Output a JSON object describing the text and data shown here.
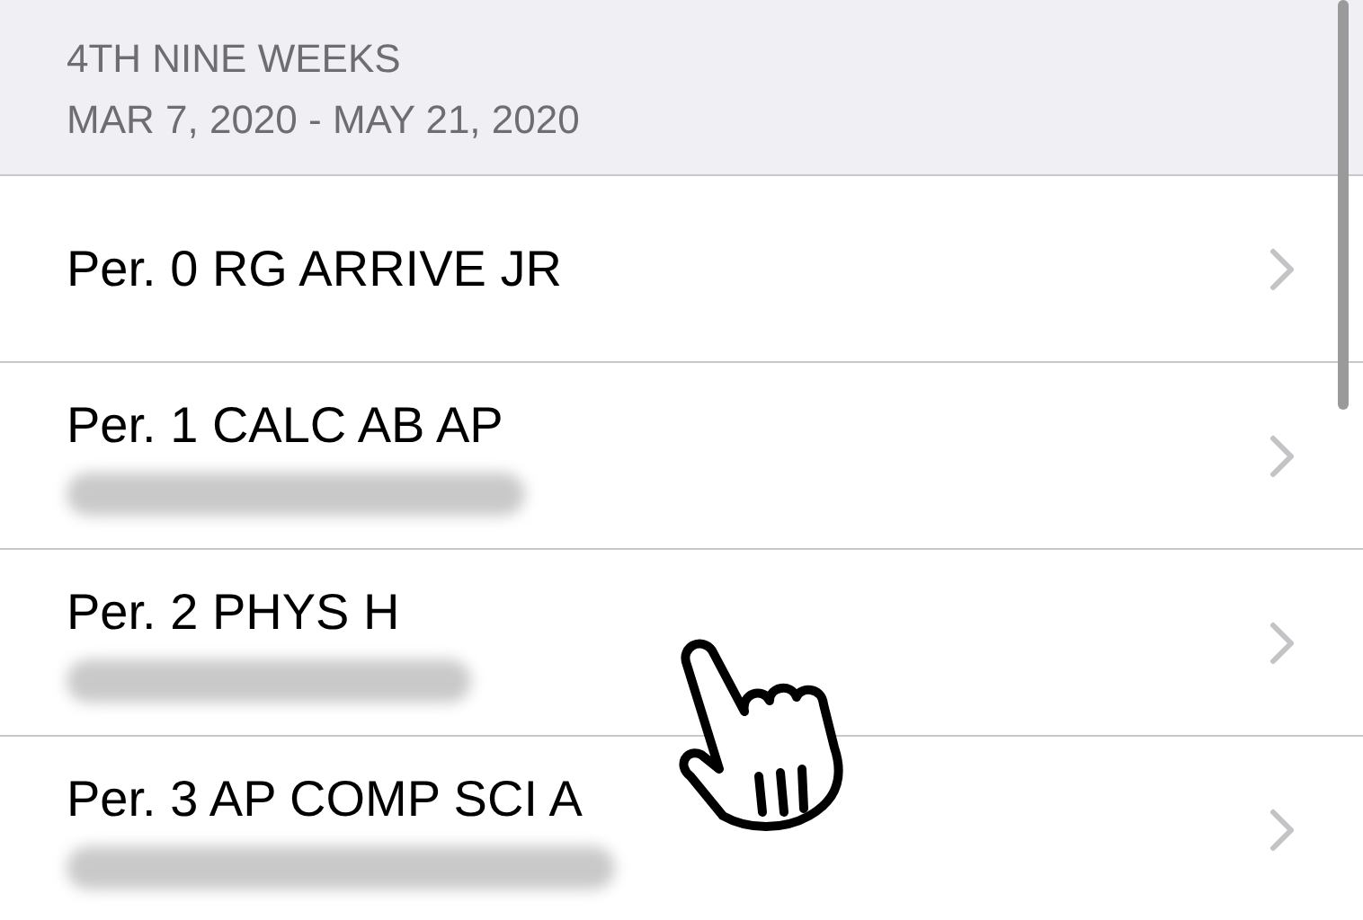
{
  "header": {
    "title": "4TH NINE WEEKS",
    "dates": "MAR 7, 2020 - MAY 21, 2020"
  },
  "rows": [
    {
      "title": "Per. 0 RG ARRIVE JR",
      "subtitle_redacted": false
    },
    {
      "title": "Per. 1 CALC AB AP",
      "subtitle_redacted": true
    },
    {
      "title": "Per. 2 PHYS H",
      "subtitle_redacted": true
    },
    {
      "title": "Per. 3 AP COMP SCI A",
      "subtitle_redacted": true
    }
  ]
}
